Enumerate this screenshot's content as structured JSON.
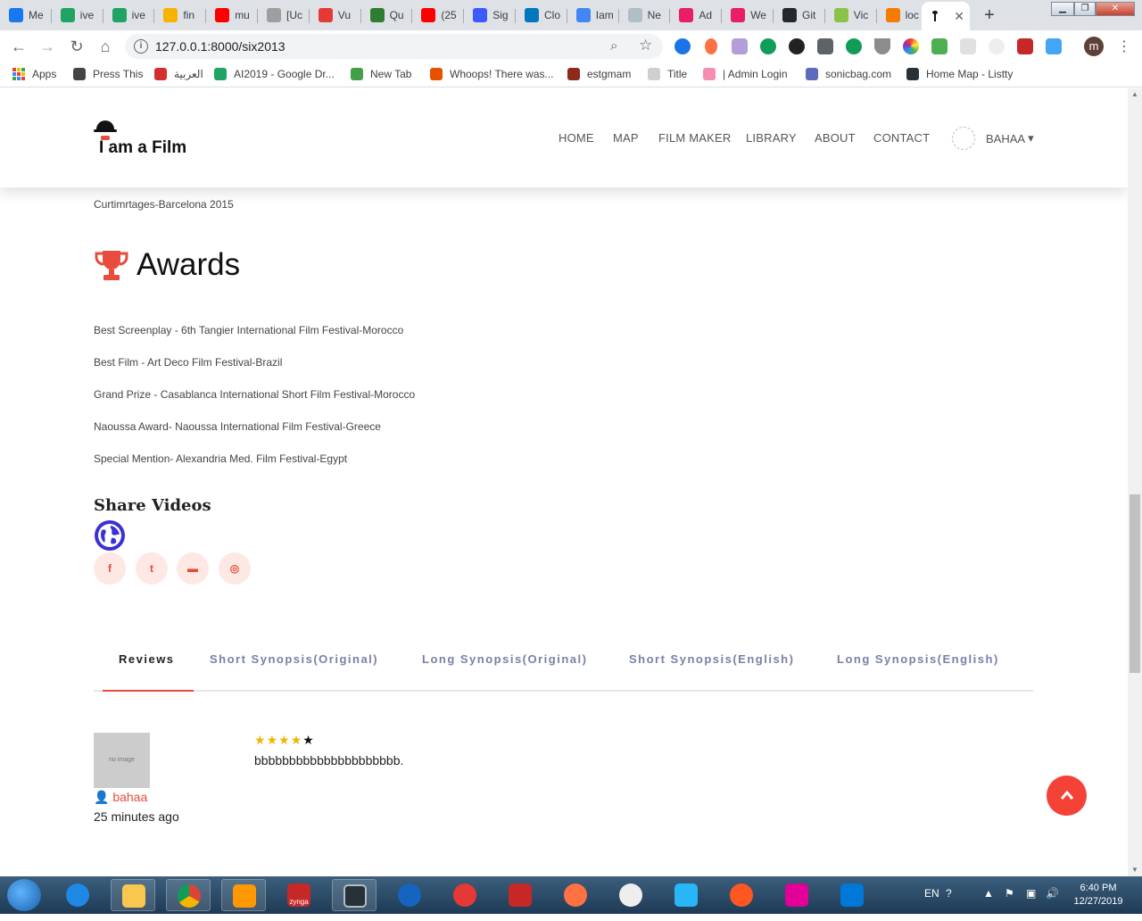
{
  "browser": {
    "tabs": [
      {
        "label": "Me",
        "color": "#1877f2"
      },
      {
        "label": "ive",
        "color": "#1fa463"
      },
      {
        "label": "ive",
        "color": "#1fa463"
      },
      {
        "label": "fin",
        "color": "#f4b400"
      },
      {
        "label": "mu",
        "color": "#ff0000"
      },
      {
        "label": "[Uc",
        "color": "#9e9e9e"
      },
      {
        "label": "Vu",
        "color": "#e53935"
      },
      {
        "label": "Qu",
        "color": "#2e7d32"
      },
      {
        "label": "(25",
        "color": "#ff0000"
      },
      {
        "label": "Sig",
        "color": "#3d5afe"
      },
      {
        "label": "Clo",
        "color": "#0277bd"
      },
      {
        "label": "Iam",
        "color": "#4285f4"
      },
      {
        "label": "Ne",
        "color": "#b0bec5"
      },
      {
        "label": "Ad",
        "color": "#e91e63"
      },
      {
        "label": "We",
        "color": "#e91e63"
      },
      {
        "label": "Git",
        "color": "#24292e"
      },
      {
        "label": "Vic",
        "color": "#8bc34a"
      },
      {
        "label": "loc",
        "color": "#f57c00"
      }
    ],
    "url": "127.0.0.1:8000/six2013",
    "profile_initial": "m",
    "bookmarks": [
      {
        "label": "Apps",
        "color": ""
      },
      {
        "label": "Press This",
        "color": "#444444"
      },
      {
        "label": "العربية",
        "color": "#d32f2f"
      },
      {
        "label": "AI2019 - Google Dr...",
        "color": "#1fa463"
      },
      {
        "label": "New Tab",
        "color": "#43a047"
      },
      {
        "label": "Whoops! There was...",
        "color": "#e65100"
      },
      {
        "label": "estgmam",
        "color": "#8d2a1a"
      },
      {
        "label": "Title",
        "color": "#cfcfcf"
      },
      {
        "label": "| Admin Login",
        "color": "#f48fb1"
      },
      {
        "label": "sonicbag.com",
        "color": "#5c6bc0"
      },
      {
        "label": "Home Map - Listty",
        "color": "#263238"
      }
    ]
  },
  "site": {
    "logo_text": "I am a Film",
    "nav": [
      "HOME",
      "MAP",
      "FILM MAKER",
      "LIBRARY",
      "ABOUT",
      "CONTACT"
    ],
    "active_nav": "HOME",
    "user_name": "BAHAA",
    "user_caret": "▾",
    "accent": "#e74c3c"
  },
  "content": {
    "festival_line": "Curtimrtages-Barcelona 2015",
    "awards_title": "Awards",
    "awards": [
      "Best Screenplay - 6th Tangier International Film Festival-Morocco",
      "Best Film - Art Deco Film Festival-Brazil",
      "Grand Prize - Casablanca International Short Film Festival-Morocco",
      "Naoussa Award- Naoussa International Film Festival-Greece",
      "Special Mention- Alexandria Med. Film Festival-Egypt"
    ],
    "share_title": "Share Videos",
    "social_icons": [
      "facebook-icon",
      "twitter-icon",
      "youtube-icon",
      "instagram-icon"
    ],
    "social_glyphs": [
      "f",
      "t",
      "▬",
      "◎"
    ],
    "tabs": [
      "Reviews",
      "Short Synopsis(Original)",
      "Long Synopsis(Original)",
      "Short Synopsis(English)",
      "Long Synopsis(English)"
    ],
    "active_tab": "Reviews",
    "review": {
      "image_placeholder": "no image",
      "author": "bahaa",
      "time": "25 minutes ago",
      "rating": 4,
      "max_rating": 5,
      "text": "bbbbbbbbbbbbbbbbbbbbb."
    }
  },
  "taskbar": {
    "language": "EN",
    "time": "6:40 PM",
    "date": "12/27/2019",
    "zynga_label": "zynga"
  }
}
